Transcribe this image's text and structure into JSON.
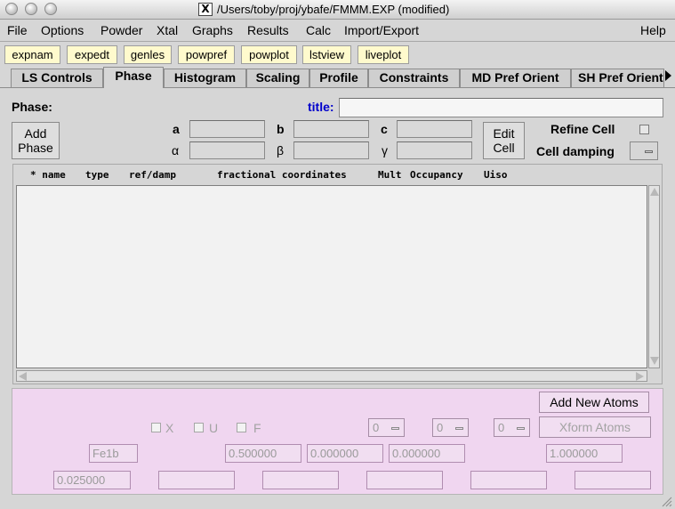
{
  "window": {
    "title": "/Users/toby/proj/ybafe/FMMM.EXP (modified)"
  },
  "menubar": {
    "items": [
      "File",
      "Options",
      "Powder",
      "Xtal",
      "Graphs",
      "Results",
      "Calc",
      "Import/Export"
    ],
    "help": "Help"
  },
  "toolbar": {
    "buttons": [
      "expnam",
      "expedt",
      "genles",
      "powpref",
      "powplot",
      "lstview",
      "liveplot"
    ]
  },
  "tabs": {
    "items": [
      "LS Controls",
      "Phase",
      "Histogram",
      "Scaling",
      "Profile",
      "Constraints",
      "MD Pref Orient",
      "SH Pref Orient"
    ],
    "selected": "Phase"
  },
  "phase": {
    "phase_label": "Phase:",
    "title_label": "title:",
    "title_value": "",
    "add_phase": "Add\nPhase",
    "cell": {
      "a": "a",
      "b": "b",
      "c": "c",
      "alpha": "α",
      "beta": "β",
      "gamma": "γ"
    },
    "edit_cell": "Edit\nCell",
    "refine_cell": "Refine Cell",
    "cell_damping": "Cell damping",
    "accent_color": "#0000cc"
  },
  "atom_list": {
    "columns": [
      "* name",
      "type",
      "ref/damp",
      "fractional coordinates",
      "Mult",
      "Occupancy",
      "Uiso"
    ]
  },
  "atom_editor": {
    "add_new_atoms": "Add New Atoms",
    "xform_atoms": "Xform Atoms",
    "flags": [
      "X",
      "U",
      "F"
    ],
    "damp_menus": [
      "0",
      "0",
      "0"
    ],
    "name": "Fe1b",
    "x": "0.500000",
    "y": "0.000000",
    "z": "0.000000",
    "occupancy": "1.000000",
    "uiso": "0.025000",
    "panel_color": "#f0d6f0"
  }
}
